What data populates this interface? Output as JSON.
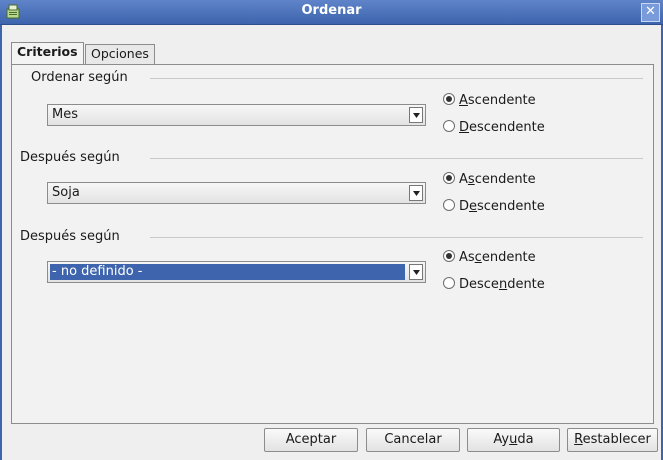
{
  "window": {
    "title": "Ordenar",
    "close_glyph": "✕"
  },
  "tabs": [
    {
      "label": "Criterios",
      "active": true
    },
    {
      "label": "Opciones",
      "active": false
    }
  ],
  "sections": [
    {
      "label": "Ordenar según",
      "combo_value": "Mes",
      "asc": {
        "pre": "",
        "mn": "A",
        "post": "scendente"
      },
      "desc": {
        "pre": "",
        "mn": "D",
        "post": "escendente"
      },
      "selected": "asc"
    },
    {
      "label": "Después según",
      "combo_value": "Soja",
      "asc": {
        "pre": "A",
        "mn": "s",
        "post": "cendente"
      },
      "desc": {
        "pre": "D",
        "mn": "e",
        "post": "scendente"
      },
      "selected": "asc"
    },
    {
      "label": "Después según",
      "combo_value": "- no definido -",
      "asc": {
        "pre": "As",
        "mn": "c",
        "post": "endente"
      },
      "desc": {
        "pre": "Desce",
        "mn": "n",
        "post": "dente"
      },
      "selected": "asc"
    }
  ],
  "buttons": {
    "ok": "Aceptar",
    "cancel": "Cancelar",
    "help": {
      "pre": "Ay",
      "mn": "u",
      "post": "da"
    },
    "reset": {
      "pre": "",
      "mn": "R",
      "post": "establecer"
    }
  },
  "colors": {
    "titlebar": "#4a70b9",
    "selection": "#3d64ad"
  },
  "icons": [
    "app-icon",
    "close-icon",
    "dropdown-arrow-icon"
  ]
}
